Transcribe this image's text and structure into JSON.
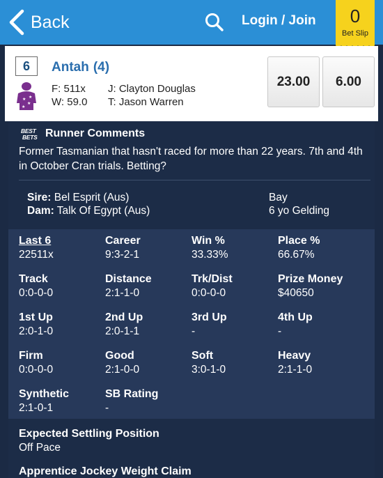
{
  "nav": {
    "back_label": "Back",
    "login_label": "Login / Join",
    "bet_slip_count": "0",
    "bet_slip_label": "Bet Slip"
  },
  "runner": {
    "number": "6",
    "name": "Antah",
    "barrier": "(4)",
    "form": "F: 511x",
    "weight": "W: 59.0",
    "jockey": "J: Clayton Douglas",
    "trainer": "T: Jason Warren",
    "win_odds": "23.00",
    "place_odds": "6.00",
    "silk_colors": {
      "body": "#7a2f8e",
      "stars": "#ffffff"
    }
  },
  "comments": {
    "logo_text": "BEST BETS",
    "title": "Runner Comments",
    "text": "Former Tasmanian that hasn't raced for more than 22 years. 7th and 4th in October Cran trials. Betting?",
    "sire_label": "Sire:",
    "sire": "Bel Esprit (Aus)",
    "dam_label": "Dam:",
    "dam": "Talk Of Egypt (Aus)",
    "colour": "Bay",
    "age_sex": "6 yo Gelding"
  },
  "stats": [
    {
      "label": "Last 6",
      "value": "22511x"
    },
    {
      "label": "Career",
      "value": "9:3-2-1"
    },
    {
      "label": "Win %",
      "value": "33.33%"
    },
    {
      "label": "Place %",
      "value": "66.67%"
    },
    {
      "label": "Track",
      "value": "0:0-0-0"
    },
    {
      "label": "Distance",
      "value": "2:1-1-0"
    },
    {
      "label": "Trk/Dist",
      "value": "0:0-0-0"
    },
    {
      "label": "Prize Money",
      "value": "$40650"
    },
    {
      "label": "1st Up",
      "value": "2:0-1-0"
    },
    {
      "label": "2nd Up",
      "value": "2:0-1-1"
    },
    {
      "label": "3rd Up",
      "value": "-"
    },
    {
      "label": "4th Up",
      "value": "-"
    },
    {
      "label": "Firm",
      "value": "0:0-0-0"
    },
    {
      "label": "Good",
      "value": "2:1-0-0"
    },
    {
      "label": "Soft",
      "value": "3:0-1-0"
    },
    {
      "label": "Heavy",
      "value": "2:1-1-0"
    },
    {
      "label": "Synthetic",
      "value": "2:1-0-1"
    },
    {
      "label": "SB Rating",
      "value": "-"
    }
  ],
  "settling": {
    "label": "Expected Settling Position",
    "value": "Off Pace",
    "apprentice_label": "Apprentice Jockey Weight Claim"
  },
  "colors": {
    "topbar": "#2b8fd6",
    "bet_slip": "#f6d21d",
    "panel_dark": "#1c2c47",
    "panel_stats": "#27395a",
    "runner_name": "#2a6eae"
  }
}
